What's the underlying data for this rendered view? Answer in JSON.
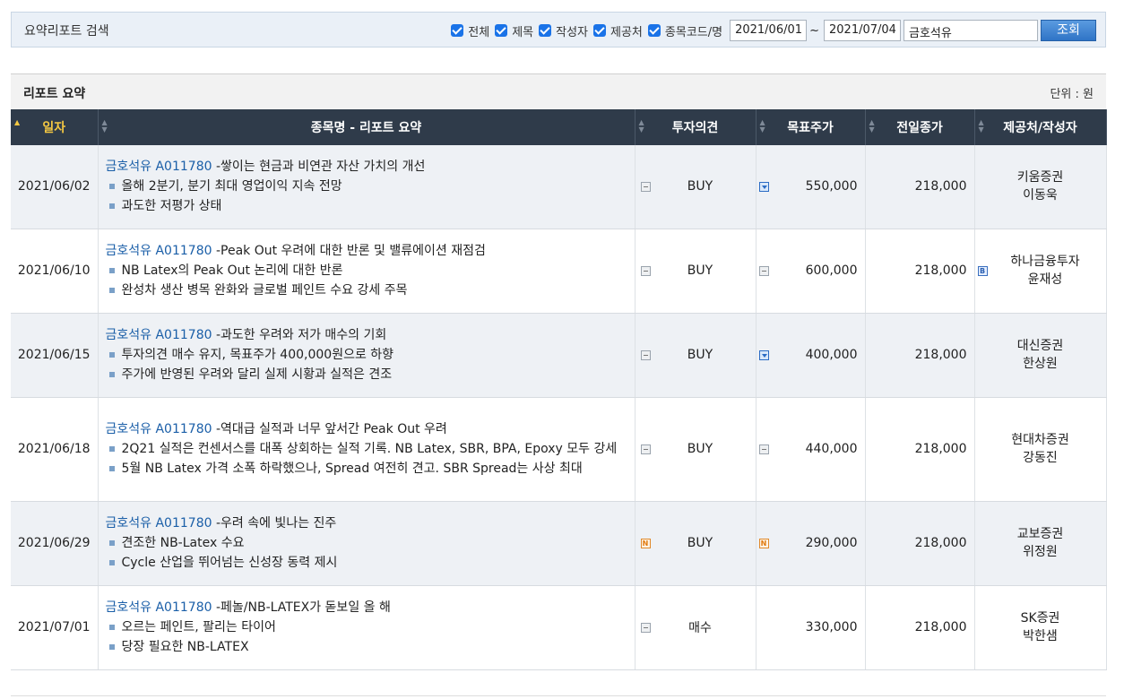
{
  "search": {
    "title": "요약리포트 검색",
    "checkboxes": [
      "전체",
      "제목",
      "작성자",
      "제공처",
      "종목코드/명"
    ],
    "date_from": "2021/06/01",
    "date_to": "2021/07/04",
    "tilde": "~",
    "query": "금호석유",
    "button": "조회"
  },
  "panel": {
    "title": "리포트 요약",
    "unit": "단위 : 원"
  },
  "columns": [
    "일자",
    "종목명 - 리포트 요약",
    "투자의견",
    "목표주가",
    "전일종가",
    "제공처/작성자"
  ],
  "rows": [
    {
      "date": "2021/06/02",
      "stock": "금호석유",
      "code": "A011780",
      "title": "-쌓이는 현금과 비연관 자산 가치의 개선",
      "bullets": [
        "올해 2분기, 분기 최대 영업이익 지속 전망",
        "과도한 저평가 상태"
      ],
      "opinion_icon": "equal-icon",
      "opinion": "BUY",
      "target_icon": "down-arrow-icon",
      "target": "550,000",
      "prev": "218,000",
      "provider_icon": "",
      "provider": "키움증권",
      "author": "이동욱"
    },
    {
      "date": "2021/06/10",
      "stock": "금호석유",
      "code": "A011780",
      "title": "-Peak Out 우려에 대한 반론 및 밸류에이션 재점검",
      "bullets": [
        "NB Latex의 Peak Out 논리에 대한 반론",
        "완성차 생산 병목 완화와 글로벌 페인트 수요 강세 주목"
      ],
      "opinion_icon": "equal-icon",
      "opinion": "BUY",
      "target_icon": "equal-icon",
      "target": "600,000",
      "prev": "218,000",
      "provider_icon": "b-icon",
      "provider": "하나금융투자",
      "author": "윤재성"
    },
    {
      "date": "2021/06/15",
      "stock": "금호석유",
      "code": "A011780",
      "title": "-과도한 우려와 저가 매수의 기회",
      "bullets": [
        "투자의견 매수 유지, 목표주가 400,000원으로 하향",
        "주가에 반영된 우려와 달리 실제 시황과 실적은 견조"
      ],
      "opinion_icon": "equal-icon",
      "opinion": "BUY",
      "target_icon": "down-arrow-icon",
      "target": "400,000",
      "prev": "218,000",
      "provider_icon": "",
      "provider": "대신증권",
      "author": "한상원"
    },
    {
      "date": "2021/06/18",
      "stock": "금호석유",
      "code": "A011780",
      "title": "-역대급 실적과 너무 앞서간 Peak Out 우려",
      "bullets": [
        "2Q21 실적은 컨센서스를 대폭 상회하는 실적 기록. NB Latex, SBR, BPA, Epoxy 모두 강세",
        "5월 NB Latex 가격 소폭 하락했으나, Spread 여전히 견고. SBR Spread는 사상 최대"
      ],
      "opinion_icon": "equal-icon",
      "opinion": "BUY",
      "target_icon": "equal-icon",
      "target": "440,000",
      "prev": "218,000",
      "provider_icon": "",
      "provider": "현대차증권",
      "author": "강동진"
    },
    {
      "date": "2021/06/29",
      "stock": "금호석유",
      "code": "A011780",
      "title": "-우려 속에 빛나는 진주",
      "bullets": [
        "견조한 NB-Latex 수요",
        "Cycle 산업을 뛰어넘는 신성장 동력 제시"
      ],
      "opinion_icon": "new-icon",
      "opinion": "BUY",
      "target_icon": "new-icon",
      "target": "290,000",
      "prev": "218,000",
      "provider_icon": "",
      "provider": "교보증권",
      "author": "위정원"
    },
    {
      "date": "2021/07/01",
      "stock": "금호석유",
      "code": "A011780",
      "title": "-페놀/NB-LATEX가 돋보일 올 해",
      "bullets": [
        "오르는 페인트, 팔리는 타이어",
        "당장 필요한 NB-LATEX"
      ],
      "opinion_icon": "equal-icon",
      "opinion": "매수",
      "target_icon": "",
      "target": "330,000",
      "prev": "218,000",
      "provider_icon": "",
      "provider": "SK증권",
      "author": "박한샘"
    }
  ]
}
